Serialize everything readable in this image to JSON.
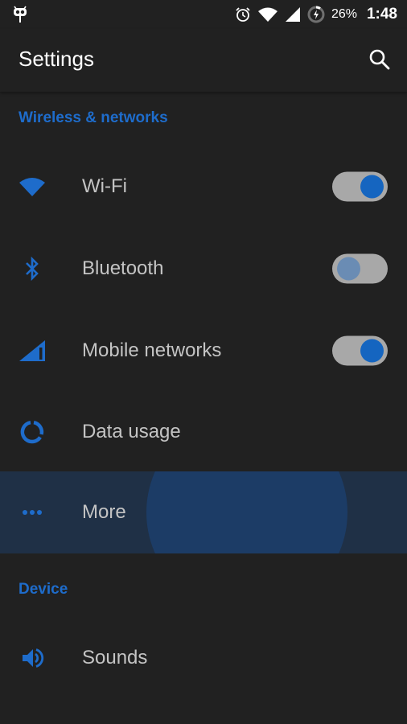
{
  "status_bar": {
    "battery_percent": "26%",
    "time": "1:48",
    "icons": [
      "cyanogen-mascot-icon",
      "alarm-icon",
      "wifi-signal-icon",
      "cell-signal-icon",
      "battery-charging-icon"
    ]
  },
  "toolbar": {
    "title": "Settings",
    "search_icon": "search-icon"
  },
  "sections": [
    {
      "header": "Wireless & networks",
      "items": [
        {
          "label": "Wi-Fi",
          "icon": "wifi-icon",
          "toggle": true,
          "toggle_state": "on"
        },
        {
          "label": "Bluetooth",
          "icon": "bluetooth-icon",
          "toggle": true,
          "toggle_state": "off"
        },
        {
          "label": "Mobile networks",
          "icon": "mobile-signal-icon",
          "toggle": true,
          "toggle_state": "on"
        },
        {
          "label": "Data usage",
          "icon": "data-usage-icon",
          "toggle": false
        },
        {
          "label": "More",
          "icon": "more-dots-icon",
          "toggle": false,
          "pressed": true
        }
      ]
    },
    {
      "header": "Device",
      "items": [
        {
          "label": "Sounds",
          "icon": "volume-icon",
          "toggle": false
        }
      ]
    }
  ],
  "colors": {
    "accent": "#1e6ccb",
    "background": "#212121",
    "toggle_track": "#a8a8a8",
    "toggle_thumb_on": "#1565c0",
    "toggle_thumb_off": "#6a8cb4",
    "pressed_row": "#1f3046"
  }
}
